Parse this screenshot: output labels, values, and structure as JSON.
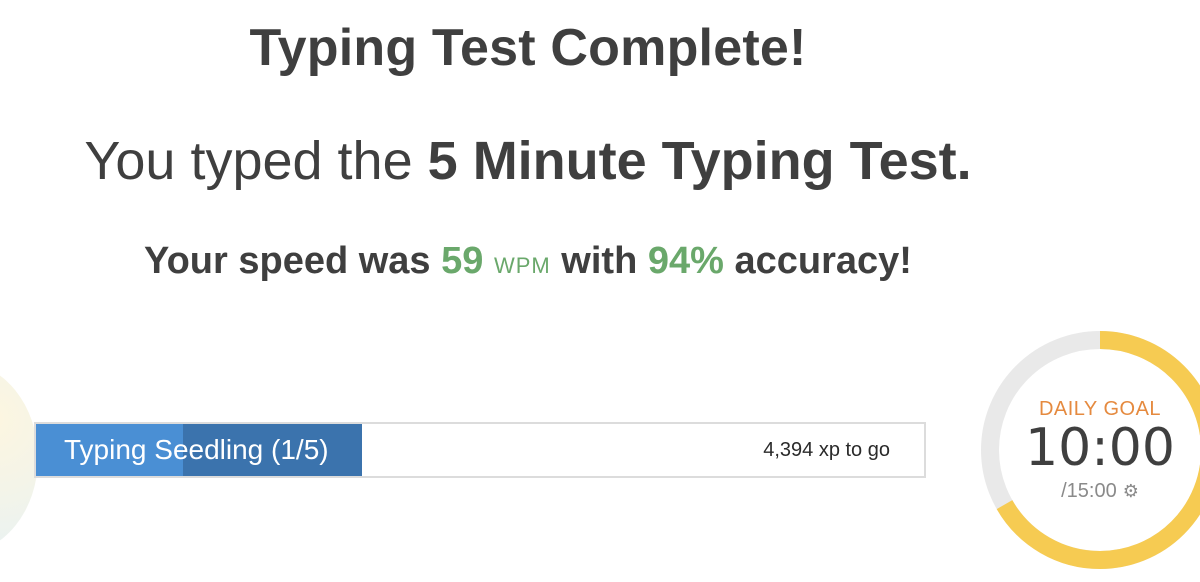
{
  "header": {
    "title": "Typing Test Complete!",
    "subtitle_prefix": "You typed the",
    "subtitle_test": "5 Minute Typing Test."
  },
  "result": {
    "prefix": "Your speed was",
    "wpm": "59",
    "wpm_unit": "WPM",
    "middle": "with",
    "accuracy": "94%",
    "suffix": "accuracy!"
  },
  "level": {
    "label": "Typing Seedling (1/5)",
    "xp_remaining": "4,394 xp to go",
    "progress_fraction": 0.367,
    "highlight_fraction": 0.165,
    "colors": {
      "fill": "#3b73ad",
      "fill_light": "#4a8fd4"
    }
  },
  "daily_goal": {
    "label": "DAILY GOAL",
    "time": "10:00",
    "target": "/15:00",
    "settings_icon": "gear-icon",
    "progress_fraction": 0.667,
    "colors": {
      "ring_fill": "#f6cb52",
      "ring_track": "#e9e9e9",
      "label": "#e58a3f"
    }
  },
  "colors": {
    "accent_green": "#6aa86b",
    "text": "#3f3f3f"
  }
}
